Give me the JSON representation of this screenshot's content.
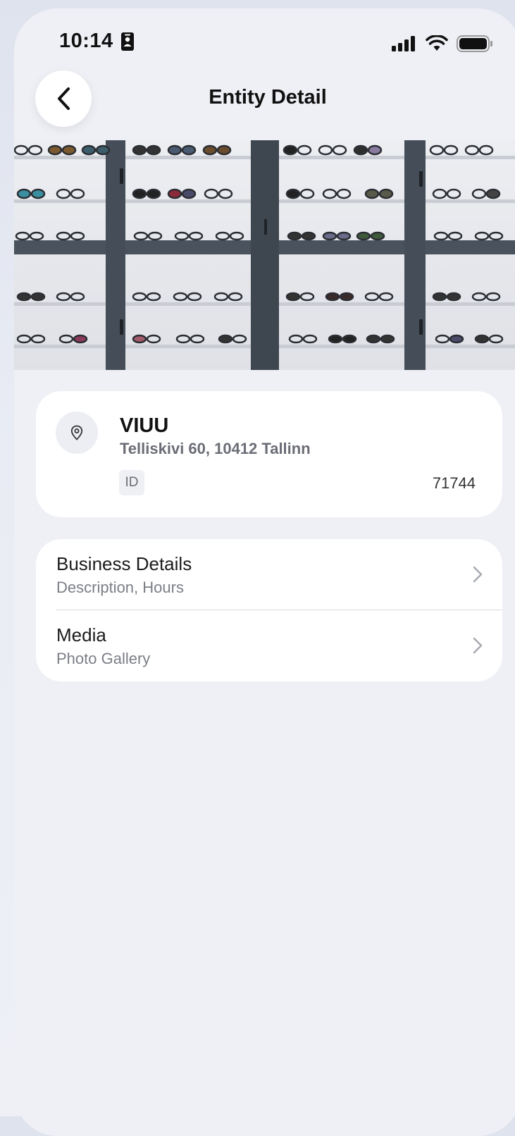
{
  "status_bar": {
    "time": "10:14",
    "icons": [
      "id-card-icon",
      "signal-icon",
      "wifi-icon",
      "battery-icon"
    ]
  },
  "nav": {
    "title": "Entity Detail",
    "back_icon": "chevron-left-icon"
  },
  "hero": {
    "image_subject": "eyeglasses display wall"
  },
  "entity": {
    "name": "VIUU",
    "address": "Telliskivi 60, 10412 Tallinn",
    "id_label": "ID",
    "id_value": "71744",
    "icon": "location-pin-icon"
  },
  "menu": [
    {
      "title": "Business Details",
      "subtitle": "Description, Hours"
    },
    {
      "title": "Media",
      "subtitle": "Photo Gallery"
    }
  ],
  "colors": {
    "background": "#eff0f6",
    "card": "#ffffff",
    "text_primary": "#111111",
    "text_secondary": "#7b7e86",
    "frame_dark": "#3f4852"
  }
}
